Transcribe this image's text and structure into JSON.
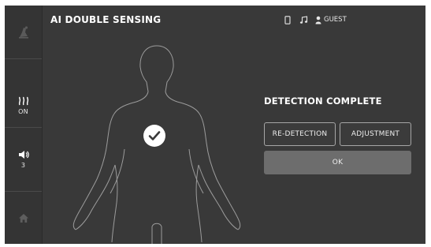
{
  "app": {
    "title": "AI DOUBLE SENSING"
  },
  "status_bar": {
    "icons": [
      "phone-icon",
      "music-note-icon",
      "user-icon"
    ],
    "user_label": "GUEST"
  },
  "sidebar": {
    "items": [
      {
        "name": "massage-chair-icon",
        "label": ""
      },
      {
        "name": "heat-icon",
        "label": "ON"
      },
      {
        "name": "volume-icon",
        "label": "3"
      },
      {
        "name": "home-icon",
        "label": ""
      }
    ]
  },
  "detection": {
    "title": "DETECTION COMPLETE",
    "status_icon": "checkmark-icon"
  },
  "actions": {
    "redetect_label": "RE-DETECTION",
    "adjust_label": "ADJUSTMENT",
    "ok_label": "OK"
  },
  "colors": {
    "background": "#393939",
    "sidebar": "#343434",
    "ok_button": "#6d6d6d",
    "outline": "#a6a6a6"
  }
}
